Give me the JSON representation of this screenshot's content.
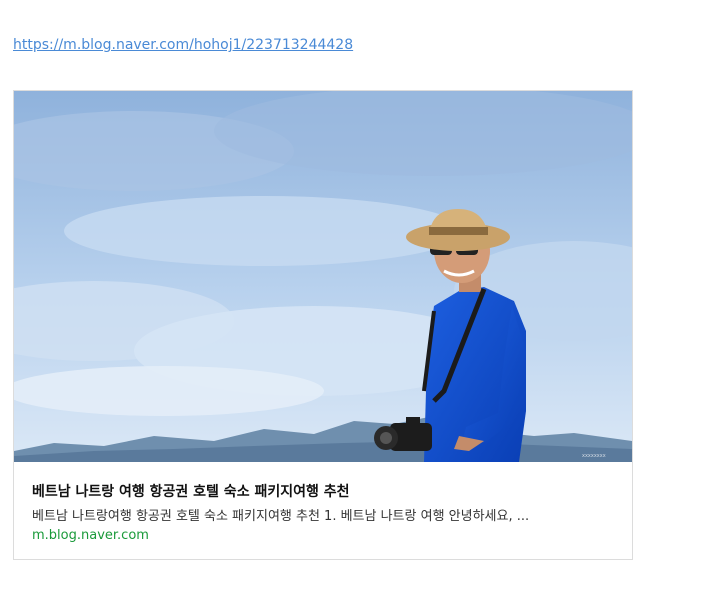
{
  "link": {
    "url": "https://m.blog.naver.com/hohoj1/223713244428"
  },
  "card": {
    "title": "베트남 나트랑 여행 항공권 호텔 숙소 패키지여행 추천",
    "description": "베트남 나트랑여행 항공권 호텔 숙소 패키지여행 추천 1. 베트남 나트랑 여행 안녕하세요, ...",
    "domain": "m.blog.naver.com",
    "image_alt": "man-with-camera-photo"
  },
  "colors": {
    "link": "#4a8ad6",
    "domain": "#1a9a3a",
    "card_border": "#dcdcdc"
  }
}
